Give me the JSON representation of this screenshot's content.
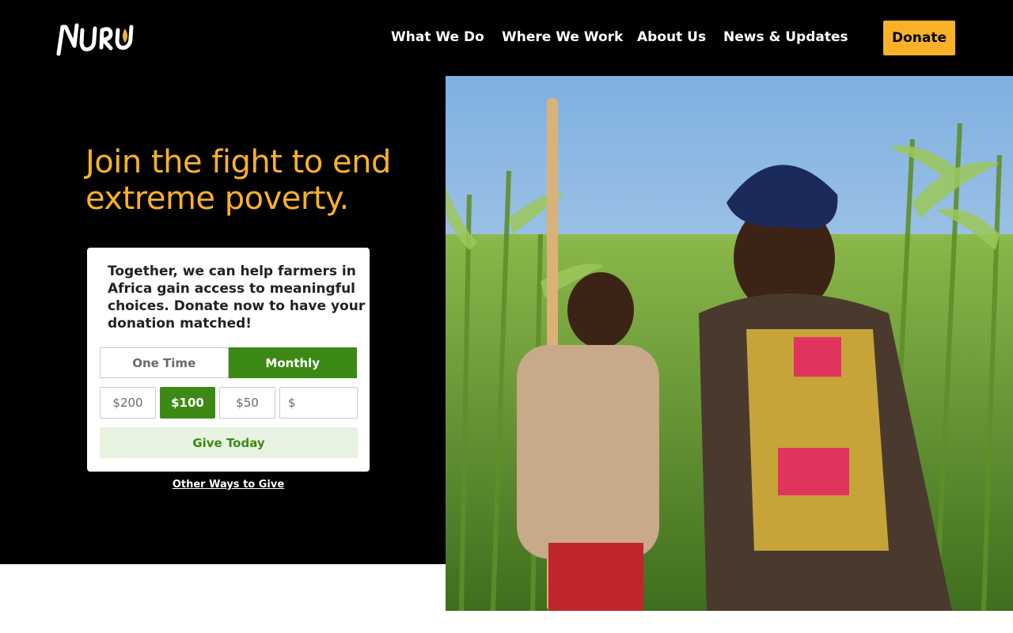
{
  "brand": {
    "name": "NURU",
    "accent": "#f9b128",
    "green": "#3c8a15"
  },
  "nav": {
    "items": [
      {
        "label": "What We Do"
      },
      {
        "label": "Where We Work"
      },
      {
        "label": "About Us"
      },
      {
        "label": "News & Updates"
      }
    ],
    "donate_label": "Donate"
  },
  "hero": {
    "headline_line1": "Join the fight to end",
    "headline_line2": "extreme poverty."
  },
  "donation": {
    "text_lines": [
      "Together, we can help farmers in",
      "Africa gain access to meaningful",
      "choices. Donate now to have your",
      "donation matched!"
    ],
    "frequency": {
      "one_time": "One Time",
      "monthly": "Monthly",
      "selected": "Monthly"
    },
    "amounts": [
      "$200",
      "$100",
      "$50"
    ],
    "selected_amount": "$100",
    "custom_currency": "$",
    "custom_value": "",
    "give_label": "Give Today"
  },
  "other_ways_label": "Other Ways to Give",
  "photo": {
    "icon": "farmers-in-cornfield-photo"
  }
}
